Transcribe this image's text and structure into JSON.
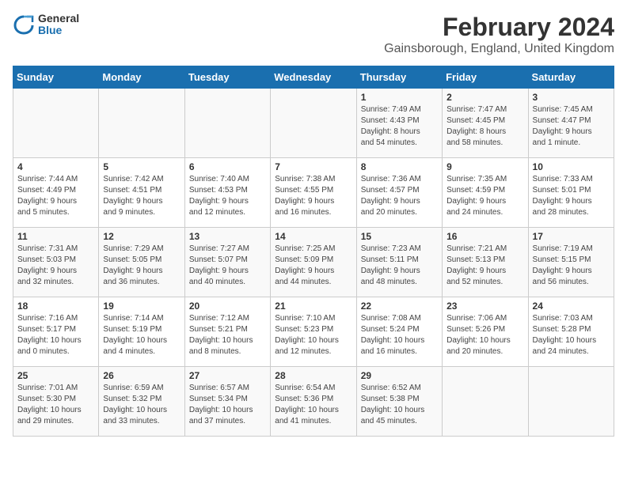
{
  "logo": {
    "general": "General",
    "blue": "Blue"
  },
  "title": "February 2024",
  "subtitle": "Gainsborough, England, United Kingdom",
  "days_header": [
    "Sunday",
    "Monday",
    "Tuesday",
    "Wednesday",
    "Thursday",
    "Friday",
    "Saturday"
  ],
  "weeks": [
    [
      {
        "day": "",
        "info": ""
      },
      {
        "day": "",
        "info": ""
      },
      {
        "day": "",
        "info": ""
      },
      {
        "day": "",
        "info": ""
      },
      {
        "day": "1",
        "info": "Sunrise: 7:49 AM\nSunset: 4:43 PM\nDaylight: 8 hours\nand 54 minutes."
      },
      {
        "day": "2",
        "info": "Sunrise: 7:47 AM\nSunset: 4:45 PM\nDaylight: 8 hours\nand 58 minutes."
      },
      {
        "day": "3",
        "info": "Sunrise: 7:45 AM\nSunset: 4:47 PM\nDaylight: 9 hours\nand 1 minute."
      }
    ],
    [
      {
        "day": "4",
        "info": "Sunrise: 7:44 AM\nSunset: 4:49 PM\nDaylight: 9 hours\nand 5 minutes."
      },
      {
        "day": "5",
        "info": "Sunrise: 7:42 AM\nSunset: 4:51 PM\nDaylight: 9 hours\nand 9 minutes."
      },
      {
        "day": "6",
        "info": "Sunrise: 7:40 AM\nSunset: 4:53 PM\nDaylight: 9 hours\nand 12 minutes."
      },
      {
        "day": "7",
        "info": "Sunrise: 7:38 AM\nSunset: 4:55 PM\nDaylight: 9 hours\nand 16 minutes."
      },
      {
        "day": "8",
        "info": "Sunrise: 7:36 AM\nSunset: 4:57 PM\nDaylight: 9 hours\nand 20 minutes."
      },
      {
        "day": "9",
        "info": "Sunrise: 7:35 AM\nSunset: 4:59 PM\nDaylight: 9 hours\nand 24 minutes."
      },
      {
        "day": "10",
        "info": "Sunrise: 7:33 AM\nSunset: 5:01 PM\nDaylight: 9 hours\nand 28 minutes."
      }
    ],
    [
      {
        "day": "11",
        "info": "Sunrise: 7:31 AM\nSunset: 5:03 PM\nDaylight: 9 hours\nand 32 minutes."
      },
      {
        "day": "12",
        "info": "Sunrise: 7:29 AM\nSunset: 5:05 PM\nDaylight: 9 hours\nand 36 minutes."
      },
      {
        "day": "13",
        "info": "Sunrise: 7:27 AM\nSunset: 5:07 PM\nDaylight: 9 hours\nand 40 minutes."
      },
      {
        "day": "14",
        "info": "Sunrise: 7:25 AM\nSunset: 5:09 PM\nDaylight: 9 hours\nand 44 minutes."
      },
      {
        "day": "15",
        "info": "Sunrise: 7:23 AM\nSunset: 5:11 PM\nDaylight: 9 hours\nand 48 minutes."
      },
      {
        "day": "16",
        "info": "Sunrise: 7:21 AM\nSunset: 5:13 PM\nDaylight: 9 hours\nand 52 minutes."
      },
      {
        "day": "17",
        "info": "Sunrise: 7:19 AM\nSunset: 5:15 PM\nDaylight: 9 hours\nand 56 minutes."
      }
    ],
    [
      {
        "day": "18",
        "info": "Sunrise: 7:16 AM\nSunset: 5:17 PM\nDaylight: 10 hours\nand 0 minutes."
      },
      {
        "day": "19",
        "info": "Sunrise: 7:14 AM\nSunset: 5:19 PM\nDaylight: 10 hours\nand 4 minutes."
      },
      {
        "day": "20",
        "info": "Sunrise: 7:12 AM\nSunset: 5:21 PM\nDaylight: 10 hours\nand 8 minutes."
      },
      {
        "day": "21",
        "info": "Sunrise: 7:10 AM\nSunset: 5:23 PM\nDaylight: 10 hours\nand 12 minutes."
      },
      {
        "day": "22",
        "info": "Sunrise: 7:08 AM\nSunset: 5:24 PM\nDaylight: 10 hours\nand 16 minutes."
      },
      {
        "day": "23",
        "info": "Sunrise: 7:06 AM\nSunset: 5:26 PM\nDaylight: 10 hours\nand 20 minutes."
      },
      {
        "day": "24",
        "info": "Sunrise: 7:03 AM\nSunset: 5:28 PM\nDaylight: 10 hours\nand 24 minutes."
      }
    ],
    [
      {
        "day": "25",
        "info": "Sunrise: 7:01 AM\nSunset: 5:30 PM\nDaylight: 10 hours\nand 29 minutes."
      },
      {
        "day": "26",
        "info": "Sunrise: 6:59 AM\nSunset: 5:32 PM\nDaylight: 10 hours\nand 33 minutes."
      },
      {
        "day": "27",
        "info": "Sunrise: 6:57 AM\nSunset: 5:34 PM\nDaylight: 10 hours\nand 37 minutes."
      },
      {
        "day": "28",
        "info": "Sunrise: 6:54 AM\nSunset: 5:36 PM\nDaylight: 10 hours\nand 41 minutes."
      },
      {
        "day": "29",
        "info": "Sunrise: 6:52 AM\nSunset: 5:38 PM\nDaylight: 10 hours\nand 45 minutes."
      },
      {
        "day": "",
        "info": ""
      },
      {
        "day": "",
        "info": ""
      }
    ]
  ]
}
